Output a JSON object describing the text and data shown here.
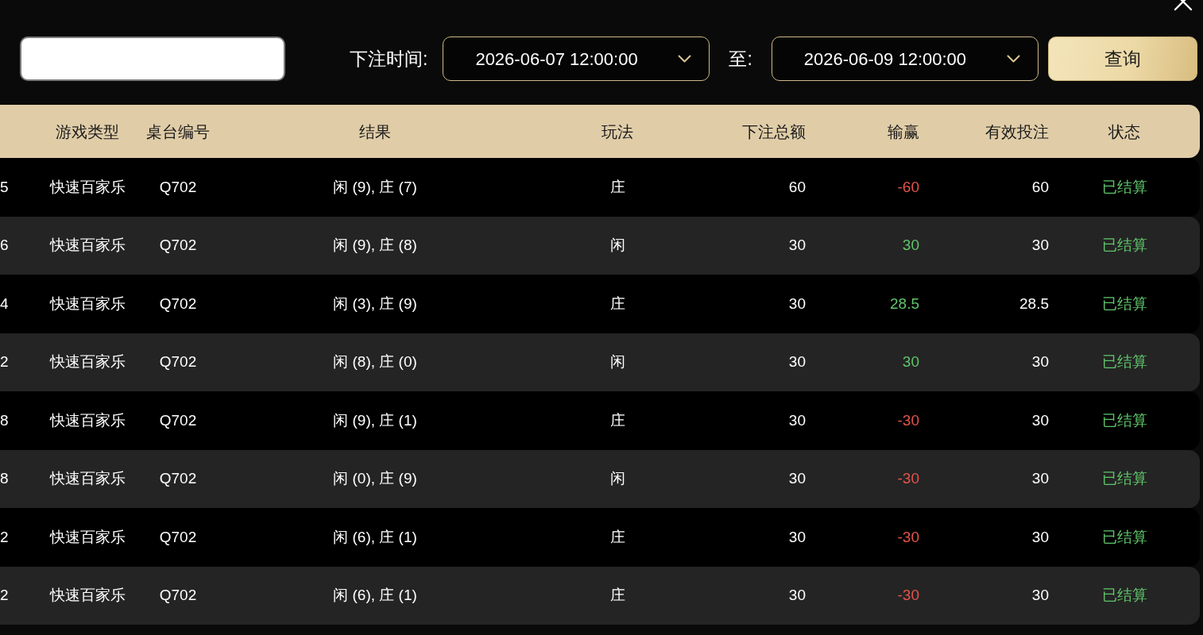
{
  "filter": {
    "bet_time_label": "下注时间:",
    "start_time": "2026-06-07 12:00:00",
    "to_label": "至:",
    "end_time": "2026-06-09 12:00:00",
    "search_button": "查询"
  },
  "table": {
    "columns": [
      "游戏类型",
      "桌台编号",
      "结果",
      "玩法",
      "下注总额",
      "输赢",
      "有效投注",
      "状态"
    ],
    "rows": [
      {
        "column_1": "5",
        "game_type": "快速百家乐",
        "table_no": "Q702",
        "result": "闲 (9), 庄 (7)",
        "bet_on": "庄",
        "total_bet": "60",
        "win_loss": "-60",
        "win": false,
        "valid_bet": "60",
        "status": "已结算"
      },
      {
        "column_1": "6",
        "game_type": "快速百家乐",
        "table_no": "Q702",
        "result": "闲 (9), 庄 (8)",
        "bet_on": "闲",
        "total_bet": "30",
        "win_loss": "30",
        "win": true,
        "valid_bet": "30",
        "status": "已结算"
      },
      {
        "column_1": "4",
        "game_type": "快速百家乐",
        "table_no": "Q702",
        "result": "闲 (3), 庄 (9)",
        "bet_on": "庄",
        "total_bet": "30",
        "win_loss": "28.5",
        "win": true,
        "valid_bet": "28.5",
        "status": "已结算"
      },
      {
        "column_1": "2",
        "game_type": "快速百家乐",
        "table_no": "Q702",
        "result": "闲 (8), 庄 (0)",
        "bet_on": "闲",
        "total_bet": "30",
        "win_loss": "30",
        "win": true,
        "valid_bet": "30",
        "status": "已结算"
      },
      {
        "column_1": "8",
        "game_type": "快速百家乐",
        "table_no": "Q702",
        "result": "闲 (9), 庄 (1)",
        "bet_on": "庄",
        "total_bet": "30",
        "win_loss": "-30",
        "win": false,
        "valid_bet": "30",
        "status": "已结算"
      },
      {
        "column_1": "8",
        "game_type": "快速百家乐",
        "table_no": "Q702",
        "result": "闲 (0), 庄 (9)",
        "bet_on": "闲",
        "total_bet": "30",
        "win_loss": "-30",
        "win": false,
        "valid_bet": "30",
        "status": "已结算"
      },
      {
        "column_1": "2",
        "game_type": "快速百家乐",
        "table_no": "Q702",
        "result": "闲 (6), 庄 (1)",
        "bet_on": "庄",
        "total_bet": "30",
        "win_loss": "-30",
        "win": false,
        "valid_bet": "30",
        "status": "已结算"
      },
      {
        "column_1": "2",
        "game_type": "快速百家乐",
        "table_no": "Q702",
        "result": "闲 (6), 庄 (1)",
        "bet_on": "庄",
        "total_bet": "30",
        "win_loss": "-30",
        "win": false,
        "valid_bet": "30",
        "status": "已结算"
      }
    ]
  }
}
